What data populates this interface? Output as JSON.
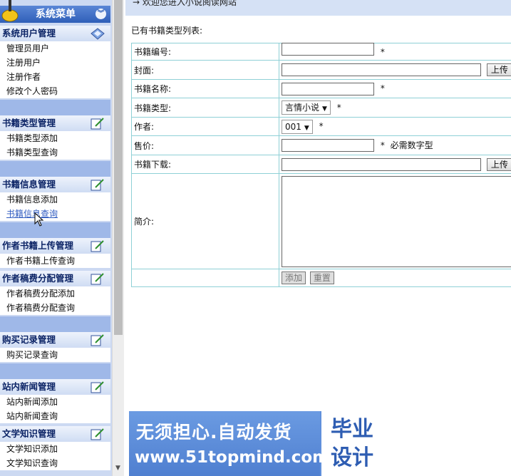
{
  "sidebar": {
    "title": "系统菜单",
    "toggle_icon": "chevron-double-down-icon",
    "groups": [
      {
        "title": "系统用户管理",
        "items": [
          "管理员用户",
          "注册用户",
          "注册作者",
          "修改个人密码"
        ]
      },
      {
        "title": "书籍类型管理",
        "items": [
          "书籍类型添加",
          "书籍类型查询"
        ]
      },
      {
        "title": "书籍信息管理",
        "items": [
          "书籍信息添加",
          "书籍信息查询"
        ]
      },
      {
        "title": "作者书籍上传管理",
        "items": [
          "作者书籍上传查询"
        ]
      },
      {
        "title": "作者稿费分配管理",
        "items": [
          "作者稿费分配添加",
          "作者稿费分配查询"
        ]
      },
      {
        "title": "购买记录管理",
        "items": [
          "购买记录查询"
        ]
      },
      {
        "title": "站内新闻管理",
        "items": [
          "站内新闻添加",
          "站内新闻查询"
        ]
      },
      {
        "title": "文学知识管理",
        "items": [
          "文学知识添加",
          "文学知识查询"
        ]
      }
    ]
  },
  "main": {
    "welcome": "→ 欢迎您进入小说阅读网站",
    "list_title": "已有书籍类型列表:",
    "form": {
      "book_id_label": "书籍编号:",
      "cover_label": "封面:",
      "name_label": "书籍名称:",
      "type_label": "书籍类型:",
      "type_value": "言情小说",
      "author_label": "作者:",
      "author_value": "001",
      "price_label": "售价:",
      "price_hint": "必需数字型",
      "download_label": "书籍下载:",
      "intro_label": "简介:",
      "upload_button": "上传",
      "required_mark": "*",
      "add_button": "添加",
      "reset_button": "重置"
    }
  },
  "banner": {
    "line1": "无须担心.自动发货",
    "line2": "www.51topmind.com",
    "right_top": "毕业",
    "right_bottom": "设计"
  }
}
